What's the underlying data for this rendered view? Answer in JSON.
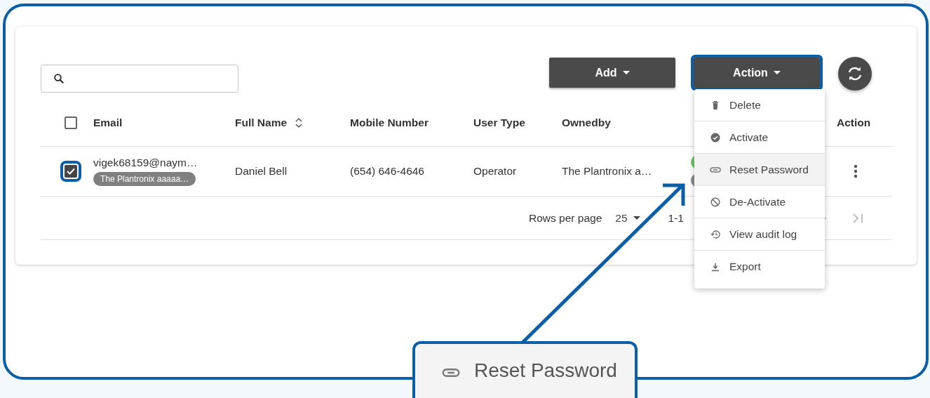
{
  "toolbar": {
    "buttons": [
      {
        "label": "Add",
        "highlighted": false
      },
      {
        "label": "Action",
        "highlighted": true
      }
    ]
  },
  "table": {
    "columns": [
      {
        "label": "Email",
        "sortable": false
      },
      {
        "label": "Full Name",
        "sortable": true
      },
      {
        "label": "Mobile Number",
        "sortable": false
      },
      {
        "label": "User Type",
        "sortable": false
      },
      {
        "label": "Ownedby",
        "sortable": false
      },
      {
        "label": "Action",
        "sortable": false
      }
    ],
    "header_checked": false,
    "rows": [
      {
        "checked": true,
        "highlighted": true,
        "email": "vigek68159@naym…",
        "tag": "The Plantronix aaaaa…",
        "full_name": "Daniel Bell",
        "mobile": "(654) 646-4646",
        "user_type": "Operator",
        "ownedby": "The Plantronix a…",
        "statuses": [
          {
            "color": "#72c267"
          },
          {
            "color": "#8c8c8c"
          }
        ]
      }
    ]
  },
  "pagination": {
    "rows_per_page_label": "Rows per page",
    "rows_per_page": "25",
    "range": "1-1"
  },
  "menu": {
    "items": [
      {
        "label": "Delete",
        "kind": "trash",
        "selected": false
      },
      {
        "label": "Activate",
        "kind": "check",
        "selected": false
      },
      {
        "label": "Reset Password",
        "kind": "link",
        "selected": true
      },
      {
        "label": "De-Activate",
        "kind": "block",
        "selected": false
      },
      {
        "label": "View audit log",
        "kind": "history",
        "selected": false
      },
      {
        "label": "Export",
        "kind": "download",
        "selected": false
      }
    ]
  },
  "callout": {
    "label": "Reset Password",
    "kind": "link"
  }
}
